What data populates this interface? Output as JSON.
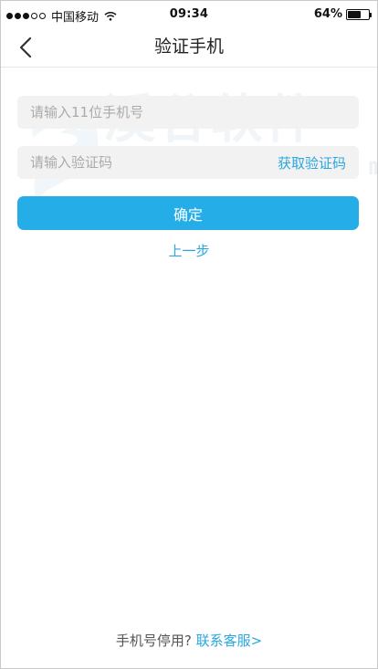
{
  "status_bar": {
    "carrier": "中国移动",
    "time": "09:34",
    "battery_percent_text": "64%",
    "battery_level": 0.64,
    "signal_dots_filled": 3,
    "signal_dots_total": 5
  },
  "nav": {
    "title": "验证手机",
    "back_icon": "chevron-left-icon"
  },
  "form": {
    "phone_placeholder": "请输入11位手机号",
    "code_placeholder": "请输入验证码",
    "get_code_label": "获取验证码",
    "confirm_label": "确定",
    "prev_step_label": "上一步"
  },
  "watermark": {
    "text_main": "溪谷软件",
    "text_sub": "v isdk .com"
  },
  "footer": {
    "question": "手机号停用?",
    "contact_label": "联系客服>"
  },
  "colors": {
    "accent": "#24ADE6",
    "link": "#2AA7DF",
    "input_bg": "#F2F2F2",
    "placeholder": "#AAAAAA"
  }
}
